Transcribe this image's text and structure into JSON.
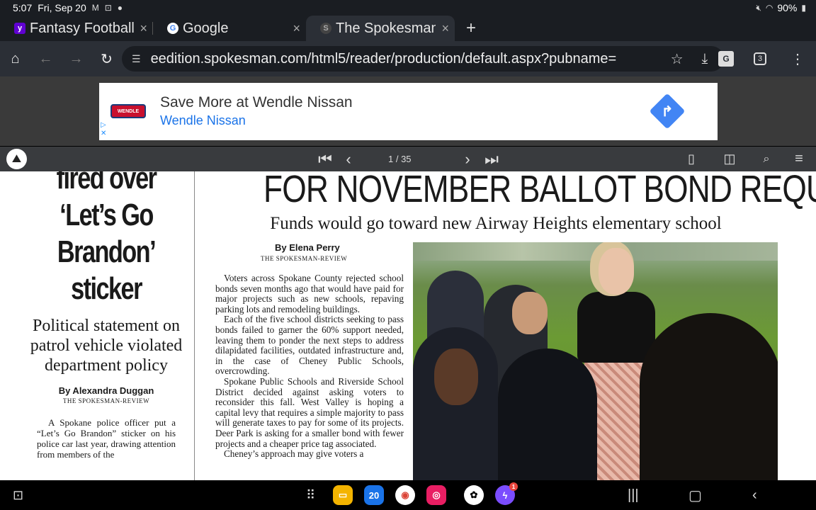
{
  "status": {
    "time": "5:07",
    "date": "Fri, Sep 20",
    "battery": "90%"
  },
  "tabs": [
    {
      "title": "Fantasy Football",
      "favicon": "yahoo-favicon",
      "close": "×"
    },
    {
      "title": "Google",
      "favicon": "google-favicon",
      "close": "×"
    },
    {
      "title": "The Spokesman-Review",
      "favicon": "spokesman-favicon",
      "close": "×"
    }
  ],
  "new_tab": "+",
  "omnibox": {
    "url": "eedition.spokesman.com/html5/reader/production/default.aspx?pubname="
  },
  "toolbar": {
    "tab_count": "3"
  },
  "ad": {
    "logo_text": "WENDLE",
    "title": "Save More at Wendle Nissan",
    "subtitle": "Wendle Nissan"
  },
  "reader": {
    "page_indicator": "1 / 35"
  },
  "article_left": {
    "headline_lines": [
      "fired over",
      "‘Let’s Go",
      "Brandon’",
      "sticker"
    ],
    "deck": "Political statement on patrol vehicle violated department policy",
    "byline": "By Alexandra Duggan",
    "org": "THE SPOKESMAN-REVIEW",
    "body": "A Spokane police officer put a “Let’s Go Brandon” sticker on his police car last year, drawing attention from members of the"
  },
  "article_main": {
    "headline": "FOR NOVEMBER BALLOT BOND REQUEST",
    "deck": "Funds would go toward new Airway Heights elementary school",
    "byline": "By Elena Perry",
    "org": "THE SPOKESMAN-REVIEW",
    "paragraphs": [
      "Voters across Spokane County rejected school bonds seven months ago that would have paid for major projects such as new schools, repaving parking lots and remodeling buildings.",
      "Each of the five school districts seeking to pass bonds failed to garner the 60% support needed, leaving them to ponder the next steps to address dilapidated facilities, outdated infrastructure and, in the case of Cheney Public Schools, overcrowding.",
      "Spokane Public Schools and Riverside School District decided against asking voters to reconsider this fall. West Valley is hoping a capital levy that requires a simple majority to pass will generate taxes to pay for some of its projects. Deer Park is asking for a smaller bond with fewer projects and a cheaper price tag associated.",
      "Cheney’s approach may give voters a"
    ]
  },
  "nav": {
    "calendar_day": "20",
    "messenger_badge": "1"
  }
}
